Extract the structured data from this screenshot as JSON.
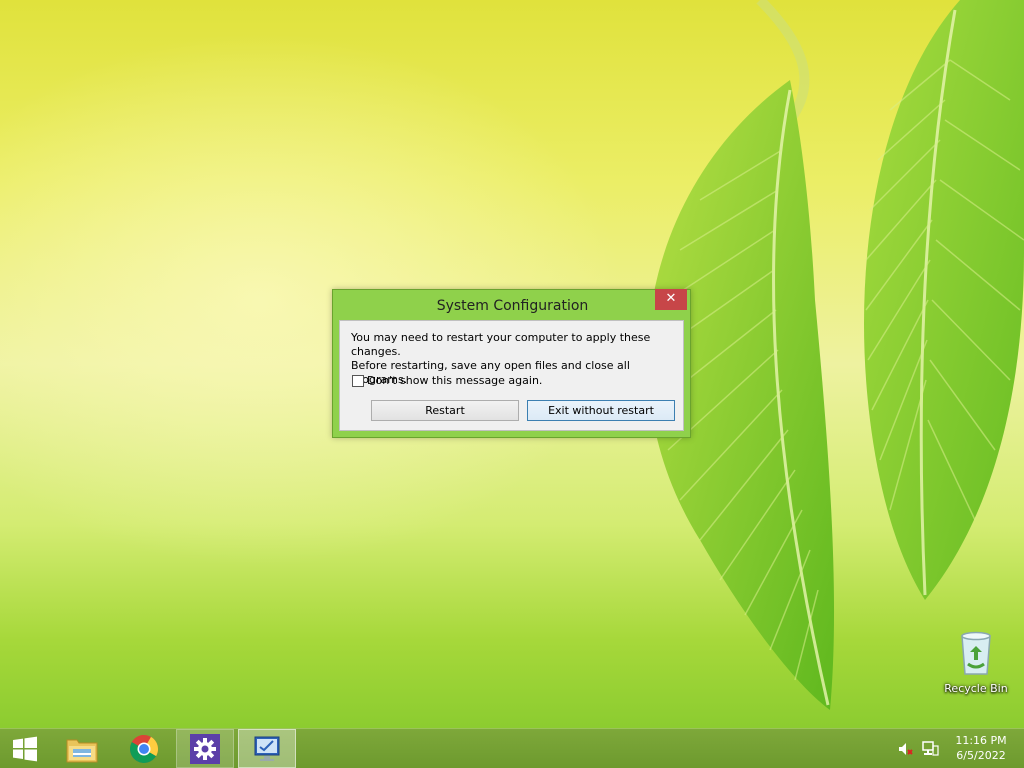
{
  "dialog": {
    "title": "System Configuration",
    "close_glyph": "✕",
    "message_line1": "You may need to restart your computer to apply these changes.",
    "message_line2": "Before restarting, save any open files and close all programs.",
    "checkbox_label": "Don't show this message again.",
    "checkbox_checked": false,
    "restart_label": "Restart",
    "exit_label": "Exit without restart"
  },
  "desktop": {
    "recycle_bin_label": "Recycle Bin"
  },
  "taskbar": {
    "items": [
      {
        "name": "start-button",
        "icon": "windows-logo-icon"
      },
      {
        "name": "file-explorer",
        "icon": "folder-icon"
      },
      {
        "name": "google-chrome",
        "icon": "chrome-icon"
      },
      {
        "name": "settings",
        "icon": "gear-icon"
      },
      {
        "name": "system-configuration",
        "icon": "msconfig-icon"
      }
    ],
    "tray": {
      "volume_icon": "speaker-muted-icon",
      "network_icon": "network-icon"
    },
    "clock": {
      "time": "11:16 PM",
      "date": "6/5/2022"
    }
  },
  "colors": {
    "dialog_frame": "#8fd14b",
    "close_button": "#c74648",
    "taskbar": "#76a234"
  }
}
